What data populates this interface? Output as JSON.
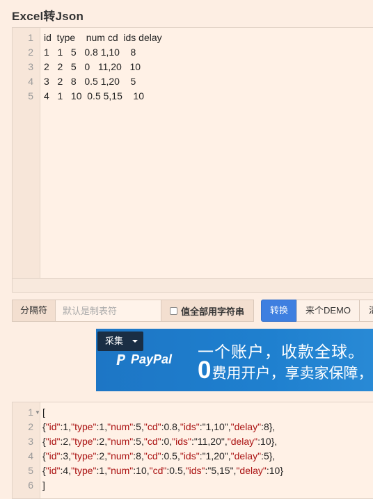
{
  "page": {
    "title": "Excel转Json"
  },
  "input_editor": {
    "lines": [
      {
        "num": "1",
        "text": "id  type    num cd  ids delay"
      },
      {
        "num": "2",
        "text": "1   1   5   0.8 1,10    8"
      },
      {
        "num": "3",
        "text": "2   2   5   0   11,20   10"
      },
      {
        "num": "4",
        "text": "3   2   8   0.5 1,20    5"
      },
      {
        "num": "5",
        "text": "4   1   10  0.5 5,15    10"
      }
    ]
  },
  "toolbar": {
    "separator_label": "分隔符",
    "separator_placeholder": "默认是制表符",
    "all_string_label": "值全部用字符串",
    "convert_label": "转换",
    "demo_label": "来个DEMO",
    "clear_label": "清"
  },
  "ad": {
    "dropdown_label": "采集",
    "brand": "PayPal",
    "line1": "一个账户，收款全球。",
    "line2_big": "0",
    "line2_rest": "费用开户，享卖家保障，"
  },
  "output_editor": {
    "lines": [
      {
        "num": "1",
        "text": "["
      },
      {
        "num": "2",
        "text": "{\"id\":1,\"type\":1,\"num\":5,\"cd\":0.8,\"ids\":\"1,10\",\"delay\":8},"
      },
      {
        "num": "3",
        "text": "{\"id\":2,\"type\":2,\"num\":5,\"cd\":0,\"ids\":\"11,20\",\"delay\":10},"
      },
      {
        "num": "4",
        "text": "{\"id\":3,\"type\":2,\"num\":8,\"cd\":0.5,\"ids\":\"1,20\",\"delay\":5},"
      },
      {
        "num": "5",
        "text": "{\"id\":4,\"type\":1,\"num\":10,\"cd\":0.5,\"ids\":\"5,15\",\"delay\":10}"
      },
      {
        "num": "6",
        "text": "]"
      }
    ]
  },
  "colors": {
    "page_bg": "#fdeee3",
    "accent": "#3e7fe0",
    "ad_bg": "#1f80cf",
    "json_key": "#a11"
  }
}
